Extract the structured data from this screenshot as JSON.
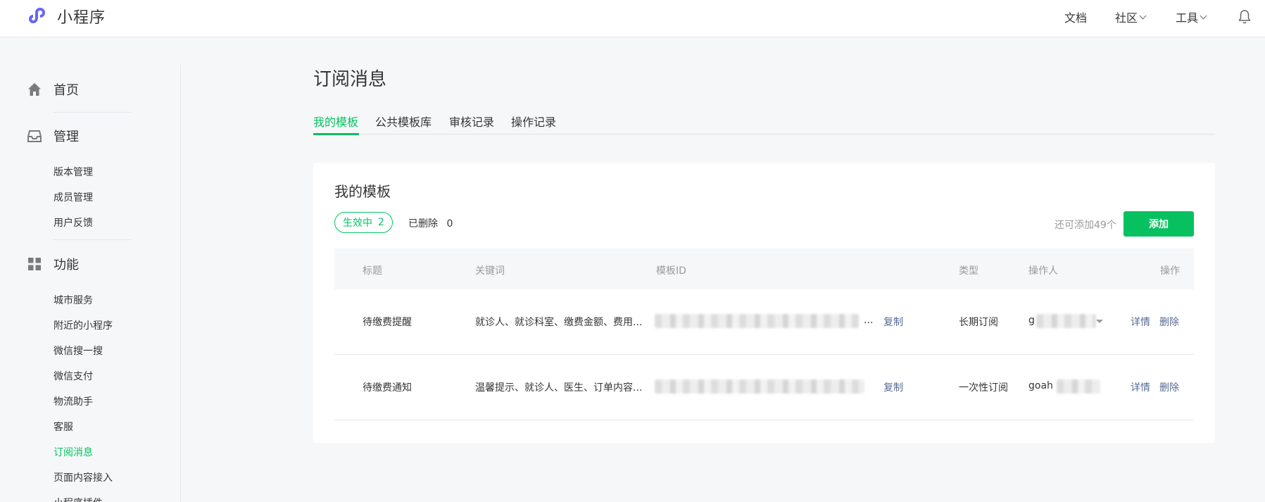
{
  "header": {
    "app_name": "小程序",
    "nav": [
      {
        "label": "文档"
      },
      {
        "label": "社区"
      },
      {
        "label": "工具"
      }
    ]
  },
  "sidebar": {
    "home": "首页",
    "manage": {
      "label": "管理",
      "items": [
        "版本管理",
        "成员管理",
        "用户反馈"
      ]
    },
    "features": {
      "label": "功能",
      "items": [
        "城市服务",
        "附近的小程序",
        "微信搜一搜",
        "微信支付",
        "物流助手",
        "客服",
        "订阅消息",
        "页面内容接入",
        "小程序插件"
      ]
    }
  },
  "main": {
    "title": "订阅消息",
    "tabs": [
      "我的模板",
      "公共模板库",
      "审核记录",
      "操作记录"
    ],
    "card": {
      "title": "我的模板",
      "active_label": "生效中",
      "active_count": "2",
      "deleted_label": "已删除",
      "deleted_count": "0",
      "remaining": "还可添加49个",
      "add_label": "添加",
      "columns": [
        "标题",
        "关键词",
        "模板ID",
        "类型",
        "操作人",
        "操作"
      ],
      "rows": [
        {
          "title": "待缴费提醒",
          "keywords": "就诊人、就诊科室、缴费金额、费用...",
          "template_id": "...",
          "copy": "复制",
          "type": "长期订阅",
          "operator": "g",
          "detail": "详情",
          "delete": "删除"
        },
        {
          "title": "待缴费通知",
          "keywords": "温馨提示、就诊人、医生、订单内容...",
          "template_id": "",
          "copy": "复制",
          "type": "一次性订阅",
          "operator": "goah",
          "detail": "详情",
          "delete": "删除"
        }
      ]
    }
  },
  "colors": {
    "brand_green": "#07c160",
    "link_blue": "#576b95",
    "logo_purple": "#6467f0"
  },
  "icons": [
    "mini-program-logo-icon",
    "chevron-down-icon",
    "bell-icon",
    "home-icon",
    "inbox-icon",
    "grid-icon",
    "caret-down-icon"
  ]
}
